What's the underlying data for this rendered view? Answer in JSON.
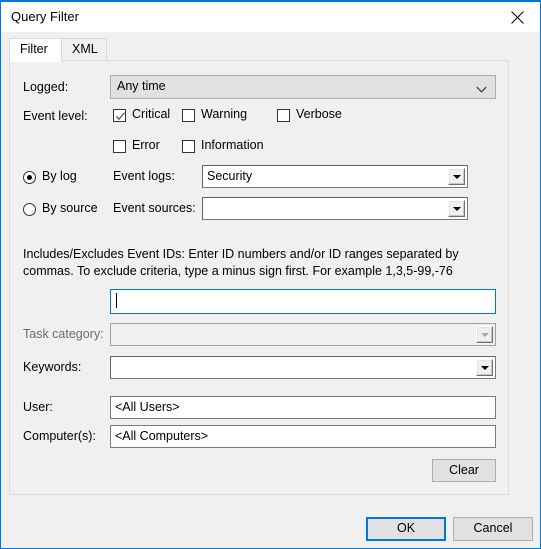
{
  "window": {
    "title": "Query Filter",
    "close_icon": "close-icon",
    "accent_color": "#0078d7"
  },
  "tabs": [
    {
      "label": "Filter",
      "active": true
    },
    {
      "label": "XML",
      "active": false
    }
  ],
  "form": {
    "logged": {
      "label": "Logged:",
      "value": "Any time",
      "chevron_icon": "chevron-down-icon"
    },
    "event_level": {
      "label": "Event level:",
      "options": [
        {
          "label": "Critical",
          "checked": true
        },
        {
          "label": "Warning",
          "checked": false
        },
        {
          "label": "Verbose",
          "checked": false
        },
        {
          "label": "Error",
          "checked": false
        },
        {
          "label": "Information",
          "checked": false
        }
      ]
    },
    "source_mode": {
      "by_log": {
        "label": "By log",
        "selected": true
      },
      "by_source": {
        "label": "By source",
        "selected": false
      }
    },
    "event_logs": {
      "label": "Event logs:",
      "value": "Security",
      "disabled": false,
      "arrow_icon": "dropdown-arrow-icon"
    },
    "event_sources": {
      "label": "Event sources:",
      "value": "",
      "disabled": false,
      "arrow_icon": "dropdown-arrow-icon"
    },
    "event_ids": {
      "help_text": "Includes/Excludes Event IDs: Enter ID numbers and/or ID ranges separated by commas. To exclude criteria, type a minus sign first. For example 1,3,5-99,-76",
      "value": "",
      "focused": true
    },
    "task_category": {
      "label": "Task category:",
      "value": "",
      "disabled": true,
      "arrow_icon": "dropdown-arrow-icon"
    },
    "keywords": {
      "label": "Keywords:",
      "value": "",
      "disabled": false,
      "arrow_icon": "dropdown-arrow-icon"
    },
    "user": {
      "label": "User:",
      "value": "<All Users>"
    },
    "computers": {
      "label": "Computer(s):",
      "value": "<All Computers>"
    },
    "clear_button": "Clear"
  },
  "footer": {
    "ok_button": "OK",
    "cancel_button": "Cancel"
  }
}
